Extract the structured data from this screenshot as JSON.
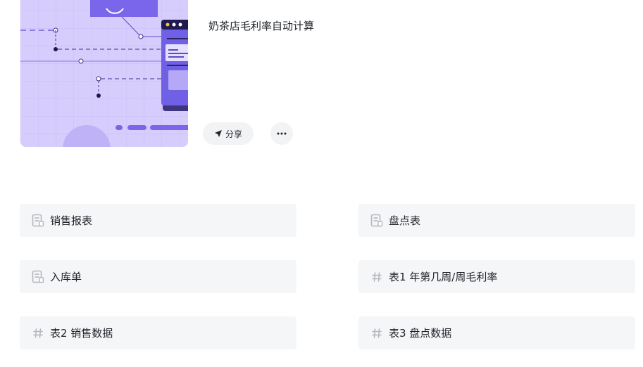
{
  "app": {
    "title": "奶茶店毛利率自动计算"
  },
  "actions": {
    "share_label": "分享",
    "more_icon": "more-horizontal-icon",
    "share_icon": "send-arrow-icon"
  },
  "items": [
    {
      "label": "销售报表",
      "icon": "document-icon"
    },
    {
      "label": "盘点表",
      "icon": "document-icon"
    },
    {
      "label": "入库单",
      "icon": "document-icon"
    },
    {
      "label": "表1 年第几周/周毛利率",
      "icon": "hash-icon"
    },
    {
      "label": "表2 销售数据",
      "icon": "hash-icon"
    },
    {
      "label": "表3 盘点数据",
      "icon": "hash-icon"
    }
  ],
  "colors": {
    "accent": "#6e5ce6",
    "cover_bg": "#d6cdfd",
    "item_bg": "#f5f6f8",
    "icon_gray": "#b5b8be"
  }
}
